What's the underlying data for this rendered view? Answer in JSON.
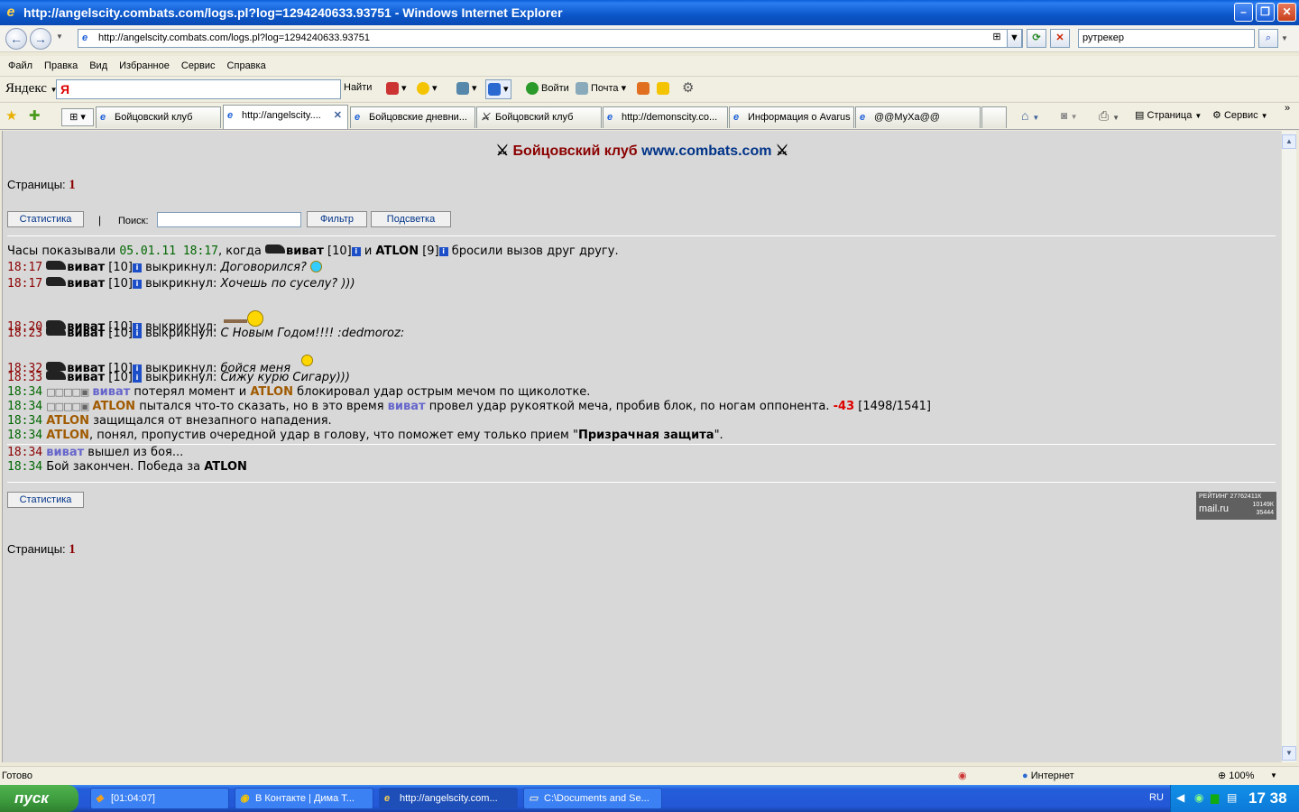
{
  "window": {
    "title": "http://angelscity.combats.com/logs.pl?log=1294240633.93751 - Windows Internet Explorer"
  },
  "address": {
    "url": "http://angelscity.combats.com/logs.pl?log=1294240633.93751",
    "search_value": "рутрекер"
  },
  "menu": [
    "Файл",
    "Правка",
    "Вид",
    "Избранное",
    "Сервис",
    "Справка"
  ],
  "yandex": {
    "logo": "Яндекс",
    "input_value": "Я",
    "find_label": "Найти",
    "login_label": "Войти",
    "mail_label": "Почта"
  },
  "tabs": [
    {
      "label": "Бойцовский клуб"
    },
    {
      "label": "http://angelscity...."
    },
    {
      "label": "Бойцовские дневни..."
    },
    {
      "label": "Бойцовский клуб"
    },
    {
      "label": "http://demonscity.co..."
    },
    {
      "label": "Информация о Avarus"
    },
    {
      "label": "@@МуХа@@"
    }
  ],
  "command_bar": {
    "page_label": "Страница",
    "tools_label": "Сервис"
  },
  "page": {
    "title_main": "Бойцовский клуб",
    "title_site": "www.combats.com",
    "pages_label": "Страницы:",
    "pages_value": "1",
    "stats_button": "Статистика",
    "separator": "|",
    "search_label": "Поиск:",
    "filter_button": "Фильтр",
    "highlight_button": "Подсветка"
  },
  "log": {
    "intro": {
      "prefix": "Часы показывали",
      "datetime": "05.01.11 18:17",
      "when": ", когда",
      "player1": "виват",
      "lvl1": "[10]",
      "and": "и",
      "player2": "ATLON",
      "lvl2": "[9]",
      "suffix": "бросили вызов друг другу."
    },
    "player": "виват",
    "level": "[10]",
    "shouted": "выкрикнул:",
    "chat": [
      {
        "time": "18:17",
        "text": "Договорился?"
      },
      {
        "time": "18:17",
        "text": "Хочешь по суселу? )))"
      },
      {
        "time": "18:20",
        "text": ""
      },
      {
        "time": "18:23",
        "text": "С Новым Годом!!!! :dedmoroz:"
      },
      {
        "time": "18:32",
        "text": "бойся меня"
      },
      {
        "time": "18:33",
        "text": "Сижу курю Сигару)))"
      }
    ],
    "battle": {
      "l1_time": "18:34",
      "l1_squares": "□□□□▣",
      "l1_a": "виват",
      "l1_b": "потерял момент и",
      "l1_c": "ATLON",
      "l1_d": "блокировал удар острым мечом по щиколотке.",
      "l2_time": "18:34",
      "l2_squares": "□□□□▣",
      "l2_a": "ATLON",
      "l2_b": "пытался что-то сказать, но в это время",
      "l2_c": "виват",
      "l2_d": "провел удар рукояткой меча, пробив блок, по ногам оппонента.",
      "l2_dmg": "-43",
      "l2_hp": "[1498/1541]",
      "l3_time": "18:34",
      "l3_a": "ATLON",
      "l3_b": "защищался от внезапного нападения.",
      "l4_time": "18:34",
      "l4_a": "ATLON",
      "l4_b": ", понял, пропустив очередной удар в голову, что поможет ему только прием \"",
      "l4_c": "Призрачная защита",
      "l4_d": "\".",
      "l5_time": "18:34",
      "l5_a": "виват",
      "l5_b": "вышел из боя...",
      "l6_time": "18:34",
      "l6_b": "Бой закончен. Победа за",
      "l6_c": "ATLON"
    }
  },
  "rating": {
    "line1": "РЕЙТИНГ 27762411К",
    "line2": "mail.ru",
    "line3": "10149К",
    "line4": "35444"
  },
  "status": {
    "text": "Готово",
    "zone": "Интернет",
    "zoom": "100%"
  },
  "taskbar": {
    "start": "пуск",
    "tasks": [
      "[01:04:07]",
      "В Контакте | Дима Т...",
      "http://angelscity.com...",
      "C:\\Documents and Se..."
    ],
    "lang": "RU",
    "clock": "17 38"
  },
  "colors": {
    "accent": "#8b0000",
    "link": "#003388",
    "nick_blue": "#6666cc",
    "nick_brown": "#a05a00"
  }
}
